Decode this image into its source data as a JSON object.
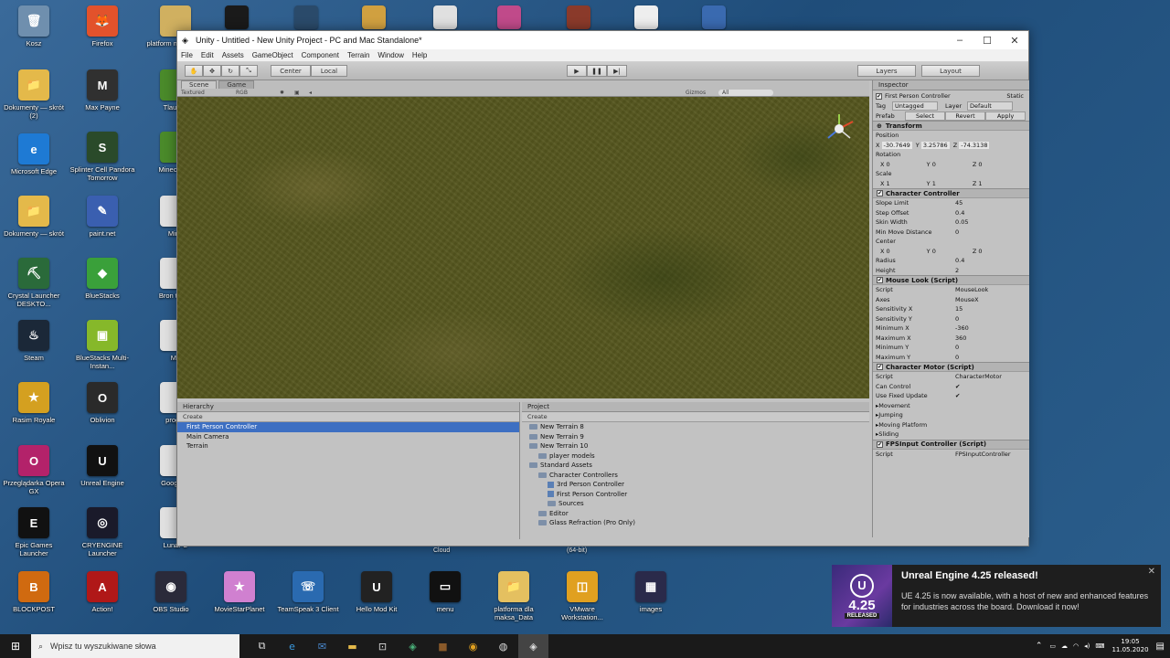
{
  "desktop_icons": [
    {
      "label": "Kosz",
      "color": "#6f8fae",
      "glyph": "🗑"
    },
    {
      "label": "Dokumenty — skrót (2)",
      "color": "#e4b94a",
      "glyph": "📁"
    },
    {
      "label": "Microsoft Edge",
      "color": "#1e7ad4",
      "glyph": "e"
    },
    {
      "label": "Dokumenty — skrót",
      "color": "#e4b94a",
      "glyph": "📁"
    },
    {
      "label": "Crystal Launcher DESKTO...",
      "color": "#2a6a3a",
      "glyph": "⛏"
    },
    {
      "label": "Steam",
      "color": "#1b2838",
      "glyph": "♨"
    },
    {
      "label": "Rasim Royale",
      "color": "#d4a020",
      "glyph": "★"
    },
    {
      "label": "Przeglądarka Opera GX",
      "color": "#b3226a",
      "glyph": "O"
    },
    {
      "label": "Epic Games Launcher",
      "color": "#111111",
      "glyph": "E"
    },
    {
      "label": "BLOCKPOST",
      "color": "#d06a10",
      "glyph": "B"
    },
    {
      "label": "Firefox",
      "color": "#e2522b",
      "glyph": "🦊"
    },
    {
      "label": "Max Payne",
      "color": "#303030",
      "glyph": "M"
    },
    {
      "label": "Splinter Cell Pandora Tomorrow",
      "color": "#2a4a2a",
      "glyph": "S"
    },
    {
      "label": "paint.net",
      "color": "#3a5fb0",
      "glyph": "✎"
    },
    {
      "label": "BlueStacks",
      "color": "#3aa03a",
      "glyph": "◆"
    },
    {
      "label": "BlueStacks Multi-Instan...",
      "color": "#86b82a",
      "glyph": "▣"
    },
    {
      "label": "Oblivion",
      "color": "#2a2a2a",
      "glyph": "O"
    },
    {
      "label": "Unreal Engine",
      "color": "#111111",
      "glyph": "U"
    },
    {
      "label": "CRYENGINE Launcher",
      "color": "#1a1a2a",
      "glyph": "◎"
    },
    {
      "label": "Action!",
      "color": "#b01818",
      "glyph": "A"
    },
    {
      "label": "platform maksa.zip",
      "color": "#d0b060",
      "glyph": ""
    },
    {
      "label": "Tlaunch",
      "color": "#4a8a2a",
      "glyph": ""
    },
    {
      "label": "Minecraft L",
      "color": "#4a8a2a",
      "glyph": ""
    },
    {
      "label": "Mine",
      "color": "#e0e0e0",
      "glyph": ""
    },
    {
      "label": "Bron to dla",
      "color": "#e0e0e0",
      "glyph": ""
    },
    {
      "label": "Mo",
      "color": "#e0e0e0",
      "glyph": ""
    },
    {
      "label": "progra",
      "color": "#e0e0e0",
      "glyph": ""
    },
    {
      "label": "Google C",
      "color": "#e0e0e0",
      "glyph": ""
    },
    {
      "label": "Lunar C",
      "color": "#e0e0e0",
      "glyph": ""
    },
    {
      "label": "OBS Studio",
      "color": "#2a2a3a",
      "glyph": "◉"
    },
    {
      "label": "MovieStarPlanet",
      "color": "#d080d0",
      "glyph": "★"
    },
    {
      "label": "TeamSpeak 3 Client",
      "color": "#2a6ab0",
      "glyph": "☏"
    },
    {
      "label": "Hello Mod Kit",
      "color": "#222222",
      "glyph": "U"
    },
    {
      "label": "menu",
      "color": "#111111",
      "glyph": "▭"
    },
    {
      "label": "platforma dla maksa_Data",
      "color": "#e4c060",
      "glyph": "📁"
    },
    {
      "label": "VMware Workstation...",
      "color": "#e0a020",
      "glyph": "◫"
    },
    {
      "label": "images",
      "color": "#2a2a4a",
      "glyph": "▦"
    }
  ],
  "loose_labels": {
    "cloud": "Cloud",
    "bit": "(64-bit)"
  },
  "window": {
    "title": "Unity - Untitled - New Unity Project - PC and Mac Standalone*",
    "menu": [
      "File",
      "Edit",
      "Assets",
      "GameObject",
      "Component",
      "Terrain",
      "Window",
      "Help"
    ],
    "toolbar": {
      "center": "Center",
      "local": "Local",
      "layers": "Layers",
      "layout": "Layout"
    },
    "scene_tabs": [
      "Scene",
      "Game"
    ],
    "scene_sub": {
      "textured": "Textured",
      "rgb": "RGB",
      "gizmos": "Gizmos",
      "all": "All"
    },
    "hierarchy": {
      "title": "Hierarchy",
      "create": "Create",
      "items": [
        "First Person Controller",
        "Main Camera",
        "Terrain"
      ]
    },
    "project": {
      "title": "Project",
      "create": "Create",
      "items": [
        {
          "label": "New Terrain 8",
          "indent": 0,
          "kind": "asset"
        },
        {
          "label": "New Terrain 9",
          "indent": 0,
          "kind": "asset"
        },
        {
          "label": "New Terrain 10",
          "indent": 0,
          "kind": "asset"
        },
        {
          "label": "player models",
          "indent": 1,
          "kind": "folder"
        },
        {
          "label": "Standard Assets",
          "indent": 0,
          "kind": "folder"
        },
        {
          "label": "Character Controllers",
          "indent": 1,
          "kind": "folder"
        },
        {
          "label": "3rd Person Controller",
          "indent": 2,
          "kind": "prefab"
        },
        {
          "label": "First Person Controller",
          "indent": 2,
          "kind": "prefab"
        },
        {
          "label": "Sources",
          "indent": 2,
          "kind": "folder"
        },
        {
          "label": "Editor",
          "indent": 1,
          "kind": "folder"
        },
        {
          "label": "Glass Refraction (Pro Only)",
          "indent": 1,
          "kind": "folder"
        }
      ]
    },
    "inspector": {
      "title": "Inspector",
      "object_name": "First Person Controller",
      "static": "Static",
      "tag_label": "Tag",
      "tag": "Untagged",
      "layer_label": "Layer",
      "layer": "Default",
      "prefab": "Prefab",
      "select": "Select",
      "revert": "Revert",
      "apply": "Apply",
      "transform": {
        "title": "Transform",
        "position": "Position",
        "px": "-30.7649",
        "py": "3.25786",
        "pz": "-74.3138",
        "rotation": "Rotation",
        "rx": "0",
        "ry": "0",
        "rz": "0",
        "scale": "Scale",
        "sx": "1",
        "sy": "1",
        "sz": "1"
      },
      "character_controller": {
        "title": "Character Controller",
        "rows": [
          [
            "Slope Limit",
            "45"
          ],
          [
            "Step Offset",
            "0.4"
          ],
          [
            "Skin Width",
            "0.05"
          ],
          [
            "Min Move Distance",
            "0"
          ]
        ],
        "center": "Center",
        "cx": "0",
        "cy": "0",
        "cz": "0",
        "rows2": [
          [
            "Radius",
            "0.4"
          ],
          [
            "Height",
            "2"
          ]
        ]
      },
      "mouse_look": {
        "title": "Mouse Look (Script)",
        "rows": [
          [
            "Script",
            "MouseLook"
          ],
          [
            "Axes",
            "MouseX"
          ],
          [
            "Sensitivity X",
            "15"
          ],
          [
            "Sensitivity Y",
            "0"
          ],
          [
            "Minimum X",
            "-360"
          ],
          [
            "Maximum X",
            "360"
          ],
          [
            "Minimum Y",
            "0"
          ],
          [
            "Maximum Y",
            "0"
          ]
        ]
      },
      "character_motor": {
        "title": "Character Motor (Script)",
        "rows": [
          [
            "Script",
            "CharacterMotor"
          ],
          [
            "Can Control",
            "✔"
          ],
          [
            "Use Fixed Update",
            "✔"
          ]
        ],
        "folds": [
          "Movement",
          "Jumping",
          "Moving Platform",
          "Sliding"
        ]
      },
      "fps_input": {
        "title": "FPSInput Controller (Script)",
        "script_label": "Script",
        "script": "FPSInputController"
      }
    }
  },
  "toast": {
    "title": "Unreal Engine 4.25 released!",
    "badge": "4.25",
    "badge_sub": "RELEASED",
    "body": "UE 4.25 is now available, with a host of new and enhanced features for industries across the board. Download it now!"
  },
  "taskbar": {
    "search_placeholder": "Wpisz tu wyszukiwane słowa",
    "time": "19:05",
    "date": "11.05.2020"
  }
}
